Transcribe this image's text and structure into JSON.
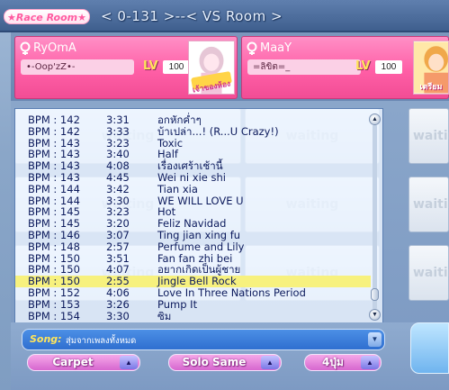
{
  "header": {
    "room_tag": "★Race Room★",
    "room_title": "< 0-131 >--< VS Room >"
  },
  "players": [
    {
      "name": "RyOmA",
      "sub": "•-Oop'zZ•-",
      "lv_label": "LV",
      "level": "100",
      "avatar_sign": "เจ้าของห้อง"
    },
    {
      "name": "MaaY",
      "sub": "=ลิขิต=_",
      "lv_label": "LV",
      "level": "100",
      "avatar_sign": "เตรียม"
    }
  ],
  "slot_label": "waiting",
  "song_list": {
    "selected_index": 15,
    "rows": [
      {
        "bpm": "BPM : 142",
        "time": "3:31",
        "title": "อกหักค่ำๆ"
      },
      {
        "bpm": "BPM : 142",
        "time": "3:33",
        "title": "บ้าเปล่า...! (R...U Crazy!)"
      },
      {
        "bpm": "BPM : 143",
        "time": "3:23",
        "title": "Toxic"
      },
      {
        "bpm": "BPM : 143",
        "time": "3:40",
        "title": "Half"
      },
      {
        "bpm": "BPM : 143",
        "time": "4:08",
        "title": "เรื่องเศร้าเช้านี้"
      },
      {
        "bpm": "BPM : 143",
        "time": "4:45",
        "title": "Wei ni xie shi"
      },
      {
        "bpm": "BPM : 144",
        "time": "3:42",
        "title": "Tian xia"
      },
      {
        "bpm": "BPM : 144",
        "time": "3:30",
        "title": "WE WILL LOVE U"
      },
      {
        "bpm": "BPM : 145",
        "time": "3:23",
        "title": "Hot"
      },
      {
        "bpm": "BPM : 145",
        "time": "3:20",
        "title": "Feliz Navidad"
      },
      {
        "bpm": "BPM : 146",
        "time": "3:07",
        "title": "Ting jian xing fu"
      },
      {
        "bpm": "BPM : 148",
        "time": "2:57",
        "title": "Perfume and Lily"
      },
      {
        "bpm": "BPM : 150",
        "time": "3:51",
        "title": " Fan fan zhi bei"
      },
      {
        "bpm": "BPM : 150",
        "time": "4:07",
        "title": "อยากเกิดเป็นผู้ชาย"
      },
      {
        "bpm": "BPM : 150",
        "time": "2:55",
        "title": "Jingle Bell Rock"
      },
      {
        "bpm": "BPM : 152",
        "time": "4:06",
        "title": "Love In Three Nations Period"
      },
      {
        "bpm": "BPM : 153",
        "time": "3:26",
        "title": "Pump It"
      },
      {
        "bpm": "BPM : 154",
        "time": "3:30",
        "title": "ซิม"
      }
    ]
  },
  "song_bar": {
    "label": "Song:",
    "value": "สุ่มจากเพลงทั้งหมด"
  },
  "dropdowns": {
    "map": "Carpet",
    "mode": "Solo Same",
    "key": "4ปุ่ม"
  },
  "icons": {
    "gender": "female-icon",
    "scroll_up": "scroll-up-arrow-icon",
    "scroll_down": "scroll-down-arrow-icon",
    "dropdown": "dropdown-arrow-icon"
  },
  "colors": {
    "player_card": "#ff5fa6",
    "selected_row": "#f7f17e",
    "song_bar": "#2f6fd0",
    "dropdown": "#d667cf",
    "list_text": "#0c1a5c"
  }
}
